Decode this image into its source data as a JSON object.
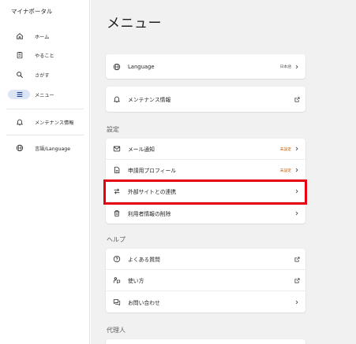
{
  "app": {
    "title": "マイナポータル"
  },
  "sidebar": {
    "items": [
      {
        "label": "ホーム",
        "icon": "home-icon"
      },
      {
        "label": "やること",
        "icon": "clipboard-icon"
      },
      {
        "label": "さがす",
        "icon": "search-icon"
      },
      {
        "label": "メニュー",
        "icon": "menu-icon",
        "selected": true
      },
      {
        "label": "メンテナンス情報",
        "icon": "bell-icon"
      },
      {
        "label": "言語/Language",
        "icon": "globe-icon"
      }
    ]
  },
  "main": {
    "title": "メニュー",
    "language_row": {
      "label": "Language",
      "value": "日本語",
      "icon": "globe-icon"
    },
    "maintenance_row": {
      "label": "メンテナンス情報",
      "icon": "bell-icon"
    },
    "settings": {
      "heading": "設定",
      "rows": [
        {
          "label": "メール通知",
          "status": "未設定",
          "icon": "mail-icon"
        },
        {
          "label": "申請用プロフィール",
          "status": "未設定",
          "icon": "document-icon"
        },
        {
          "label": "外部サイトとの連携",
          "icon": "swap-icon"
        },
        {
          "label": "利用者情報の削除",
          "icon": "trash-icon"
        }
      ]
    },
    "help": {
      "heading": "ヘルプ",
      "rows": [
        {
          "label": "よくある質問",
          "icon": "help-circle-icon"
        },
        {
          "label": "使い方",
          "icon": "guide-icon"
        },
        {
          "label": "お問い合わせ",
          "icon": "chat-icon"
        }
      ]
    },
    "proxy": {
      "heading": "代理人"
    }
  },
  "colors": {
    "accent": "#dbe5f6",
    "warning": "#c45a00",
    "highlight": "#e60012",
    "background": "#f1f1f1"
  }
}
